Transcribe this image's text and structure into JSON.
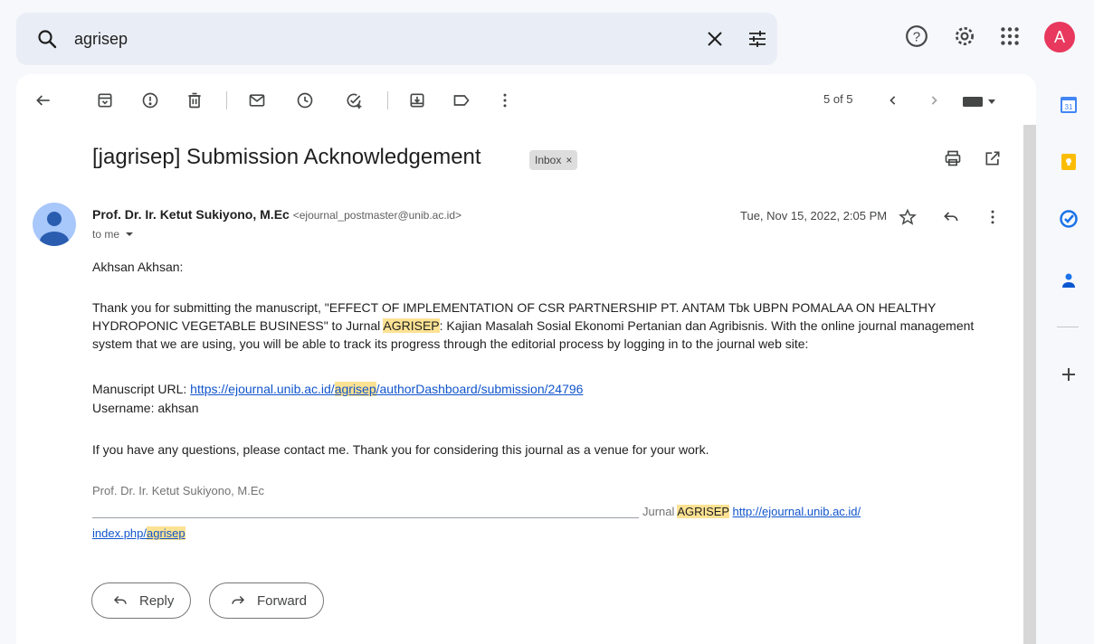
{
  "search": {
    "value": "agrisep"
  },
  "account": {
    "initial": "A",
    "color": "#e8385e"
  },
  "toolbar": {
    "pager": "5 of 5"
  },
  "email": {
    "subject": "[jagrisep] Submission Acknowledgement",
    "label": "Inbox",
    "label_remove": "×",
    "sender_name": "Prof. Dr. Ir. Ketut Sukiyono, M.Ec",
    "sender_email": "<ejournal_postmaster@unib.ac.id>",
    "to": "to me",
    "date": "Tue, Nov 15, 2022, 2:05 PM",
    "greeting": "Akhsan Akhsan:",
    "p1_a": "Thank you for submitting the manuscript, \"EFFECT OF IMPLEMENTATION OF CSR PARTNERSHIP PT. ANTAM Tbk UBPN POMALAA ON HEALTHY HYDROPONIC VEGETABLE BUSINESS\" to Jurnal ",
    "p1_hl": "AGRISEP",
    "p1_b": ": Kajian Masalah Sosial Ekonomi Pertanian dan Agribisnis. With the online journal management system that we are using, you will be able to track its progress through the editorial process by logging in to the journal web site:",
    "url_label": "Manuscript URL: ",
    "url_a": "https://ejournal.unib.ac.id/",
    "url_hl": "agrisep",
    "url_b": "/authorDashboard/submission/24796",
    "username": "Username: akhsan",
    "p2": "If you have any questions, please contact me. Thank you for considering this journal as a venue for your work.",
    "signature": "Prof. Dr. Ir. Ketut Sukiyono, M.Ec",
    "footer_prefix": "Jurnal ",
    "footer_hl": "AGRISEP",
    "footer_link_a": "http://ejournal.unib.ac.id/",
    "footer_link_b": "index.php/",
    "footer_link_hl": "agrisep"
  },
  "actions": {
    "reply": "Reply",
    "forward": "Forward"
  },
  "colors": {
    "highlight": "#fde293",
    "link": "#1155cc"
  }
}
